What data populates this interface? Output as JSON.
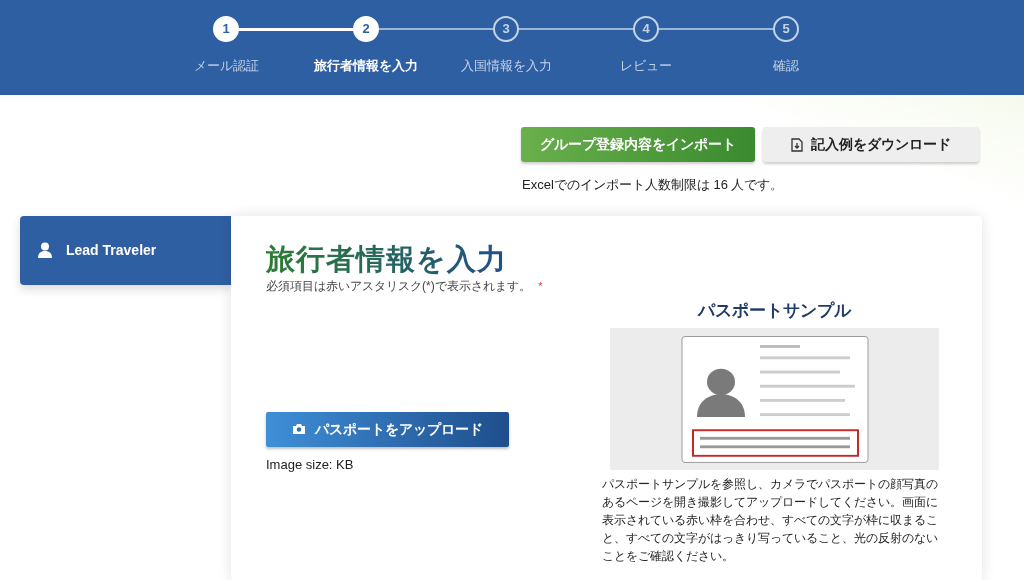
{
  "steps": [
    {
      "number": "1",
      "label": "メール認証",
      "reached": true,
      "selected": false
    },
    {
      "number": "2",
      "label": "旅行者情報を入力",
      "reached": true,
      "selected": true
    },
    {
      "number": "3",
      "label": "入国情報を入力",
      "reached": false,
      "selected": false
    },
    {
      "number": "4",
      "label": "レビュー",
      "reached": false,
      "selected": false
    },
    {
      "number": "5",
      "label": "確認",
      "reached": false,
      "selected": false
    }
  ],
  "import_button": "グループ登録内容をインポート",
  "download_button": "記入例をダウンロード",
  "import_note": "Excelでのインポート人数制限は 16 人です。",
  "travelers": [
    {
      "label": "Lead Traveler",
      "selected": true
    }
  ],
  "form": {
    "title": "旅行者情報を入力",
    "required_note": "必須項目は赤いアスタリスク(*)で表示されます。",
    "required_mark": "*",
    "upload_button": "パスポートをアップロード",
    "image_size": "Image size: KB",
    "sample_title": "パスポートサンプル",
    "sample_text": "パスポートサンプルを参照し、カメラでパスポートの顔写真のあるページを開き撮影してアップロードしてください。画面に表示されている赤い枠を合わせ、すべての文字が枠に収まること、すべての文字がはっきり写っていること、光の反射のないことをご確認ください。"
  }
}
